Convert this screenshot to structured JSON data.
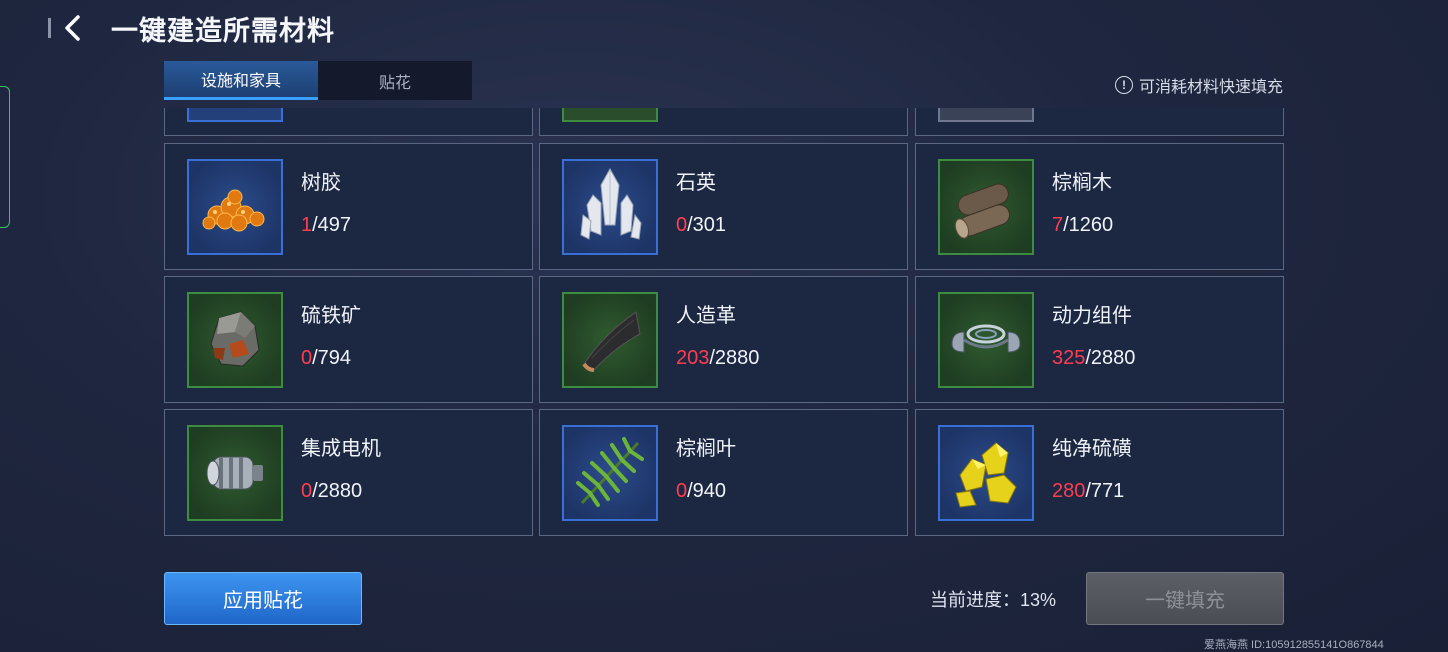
{
  "header": {
    "title": "一键建造所需材料",
    "back_icon": "chevron-left-icon"
  },
  "tabs": [
    {
      "label": "设施和家具",
      "active": true
    },
    {
      "label": "贴花",
      "active": false
    }
  ],
  "hint": {
    "icon": "info-icon",
    "label": "可消耗材料快速填充"
  },
  "materials": [
    {
      "name": "树胶",
      "have": "1",
      "need": "/497",
      "frame": "blue",
      "icon": "resin-icon"
    },
    {
      "name": "石英",
      "have": "0",
      "need": "/301",
      "frame": "blue",
      "icon": "quartz-icon"
    },
    {
      "name": "棕榈木",
      "have": "7",
      "need": "/1260",
      "frame": "green",
      "icon": "palm-wood-icon"
    },
    {
      "name": "硫铁矿",
      "have": "0",
      "need": "/794",
      "frame": "green",
      "icon": "pyrite-icon"
    },
    {
      "name": "人造革",
      "have": "203",
      "need": "/2880",
      "frame": "green",
      "icon": "leather-icon"
    },
    {
      "name": "动力组件",
      "have": "325",
      "need": "/2880",
      "frame": "green",
      "icon": "power-component-icon"
    },
    {
      "name": "集成电机",
      "have": "0",
      "need": "/2880",
      "frame": "green",
      "icon": "motor-icon"
    },
    {
      "name": "棕榈叶",
      "have": "0",
      "need": "/940",
      "frame": "blue",
      "icon": "palm-leaf-icon"
    },
    {
      "name": "纯净硫磺",
      "have": "280",
      "need": "/771",
      "frame": "blue",
      "icon": "sulfur-icon"
    }
  ],
  "footer": {
    "apply_label": "应用贴花",
    "progress_text": "当前进度：13%",
    "fill_label": "一键填充"
  },
  "watermark": "爱燕海燕 ID:105912855141O867844",
  "colors": {
    "accent": "#2f7fe0",
    "have_count": "#ff3d50",
    "blue_frame": "#3a6fd8",
    "green_frame": "#3d8c3f"
  }
}
